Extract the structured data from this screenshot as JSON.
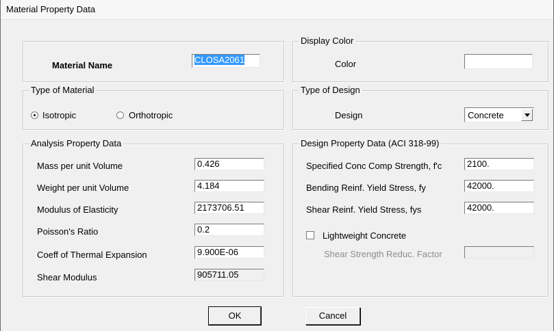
{
  "window": {
    "title": "Material Property Data"
  },
  "material_name": {
    "label": "Material Name",
    "value": "CLOSA2061"
  },
  "display_color": {
    "legend": "Display Color",
    "label": "Color",
    "color": "#ffffff"
  },
  "type_of_material": {
    "legend": "Type of Material",
    "options": [
      "Isotropic",
      "Orthotropic"
    ],
    "selected": "Isotropic"
  },
  "type_of_design": {
    "legend": "Type of Design",
    "label": "Design",
    "value": "Concrete"
  },
  "analysis": {
    "legend": "Analysis Property Data",
    "rows": [
      {
        "label": "Mass per unit Volume",
        "value": "0.426"
      },
      {
        "label": "Weight per unit Volume",
        "value": "4.184"
      },
      {
        "label": "Modulus of Elasticity",
        "value": "2173706.51"
      },
      {
        "label": "Poisson's Ratio",
        "value": "0.2"
      },
      {
        "label": "Coeff of Thermal Expansion",
        "value": "9.900E-06"
      },
      {
        "label": "Shear Modulus",
        "value": "905711.05"
      }
    ]
  },
  "design": {
    "legend": "Design Property Data (ACI 318-99)",
    "rows": [
      {
        "label": "Specified Conc Comp Strength, f'c",
        "value": "2100."
      },
      {
        "label": "Bending Reinf. Yield Stress, fy",
        "value": "42000."
      },
      {
        "label": "Shear Reinf. Yield Stress, fys",
        "value": "42000."
      }
    ],
    "lightweight_label": "Lightweight Concrete",
    "lightweight_checked": false,
    "shear_reduc_label": "Shear Strength Reduc. Factor",
    "shear_reduc_value": ""
  },
  "buttons": {
    "ok": "OK",
    "cancel": "Cancel"
  }
}
